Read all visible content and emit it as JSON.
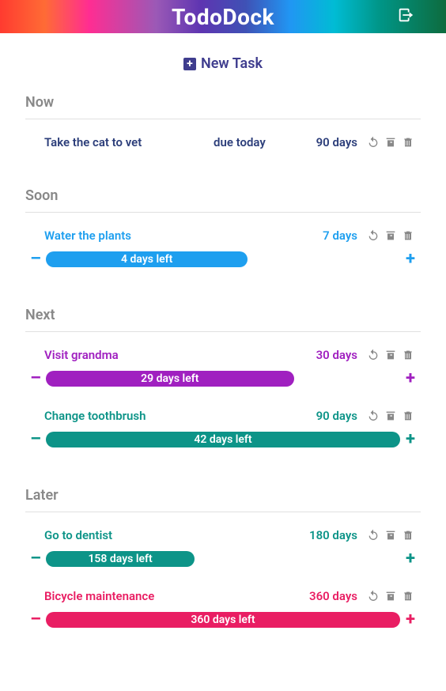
{
  "app": {
    "title": "TodoDock",
    "new_task_label": "New Task"
  },
  "sections": {
    "now": {
      "title": "Now"
    },
    "soon": {
      "title": "Soon"
    },
    "next": {
      "title": "Next"
    },
    "later": {
      "title": "Later"
    }
  },
  "tasks": {
    "cat": {
      "name": "Take the cat to vet",
      "due": "due today",
      "period": "90 days",
      "color": "#2c3e7a"
    },
    "plants": {
      "name": "Water the plants",
      "period": "7 days",
      "progress_label": "4 days left",
      "progress_pct": 57,
      "color": "#1e9fef"
    },
    "grandma": {
      "name": "Visit grandma",
      "period": "30 days",
      "progress_label": "29 days left",
      "progress_pct": 70,
      "color": "#a020c0"
    },
    "toothbrush": {
      "name": "Change toothbrush",
      "period": "90 days",
      "progress_label": "42 days left",
      "progress_pct": 100,
      "color": "#0d9488"
    },
    "dentist": {
      "name": "Go to dentist",
      "period": "180 days",
      "progress_label": "158 days left",
      "progress_pct": 42,
      "color": "#0d9488"
    },
    "bicycle": {
      "name": "Bicycle maintenance",
      "period": "360 days",
      "progress_label": "360 days left",
      "progress_pct": 100,
      "color": "#e91e63"
    }
  },
  "minus": "–",
  "plus": "+"
}
